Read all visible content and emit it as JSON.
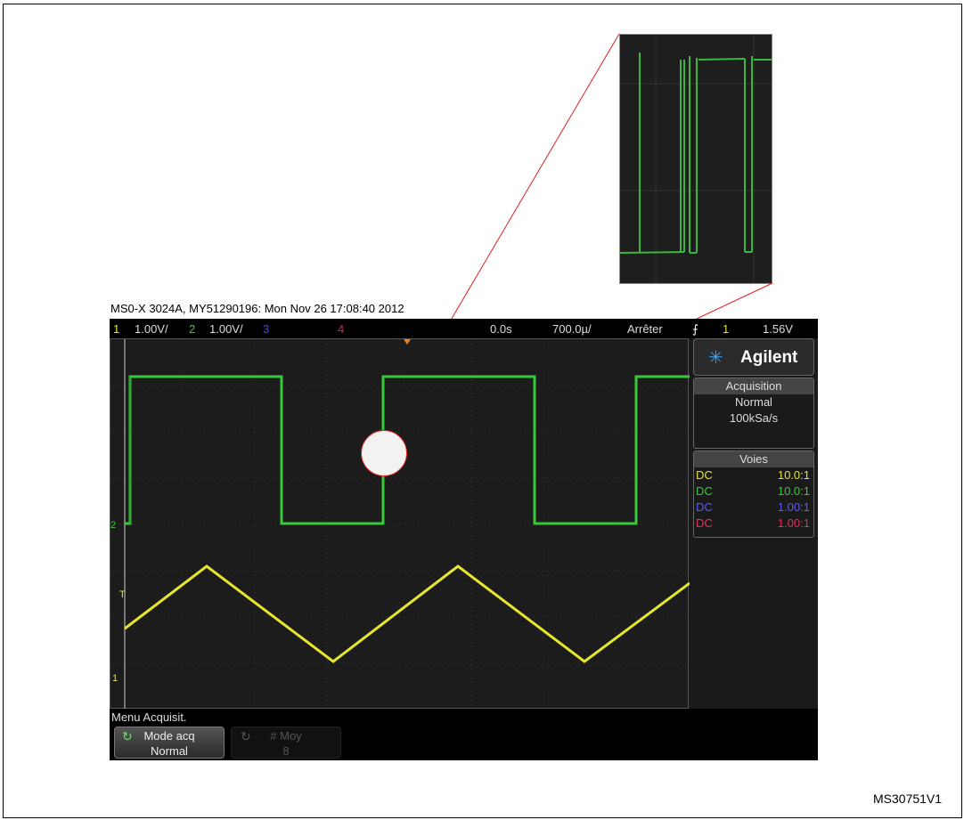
{
  "header": {
    "instrument": "MS0-X 3024A, MY51290196: Mon Nov 26 17:08:40 2012"
  },
  "topbar": {
    "ch1_num": "1",
    "ch1_scale": "1.00V/",
    "ch2_num": "2",
    "ch2_scale": "1.00V/",
    "ch3_num": "3",
    "ch4_num": "4",
    "time_offset": "0.0s",
    "time_scale": "700.0µ/",
    "run_state": "Arrêter",
    "trigger_icon": "trigger-edge-icon",
    "trigger_src": "1",
    "trigger_level": "1.56V"
  },
  "brand": {
    "name": "Agilent",
    "icon": "agilent-spark-icon"
  },
  "acquisition": {
    "title": "Acquisition",
    "mode": "Normal",
    "rate": "100kSa/s"
  },
  "voies": {
    "title": "Voies",
    "channels": [
      {
        "coupling": "DC",
        "probe": "10.0:1",
        "color": "#e6e62e"
      },
      {
        "coupling": "DC",
        "probe": "10.0:1",
        "color": "#39c83c"
      },
      {
        "coupling": "DC",
        "probe": "1.00:1",
        "color": "#5a5aff"
      },
      {
        "coupling": "DC",
        "probe": "1.00:1",
        "color": "#e8305a"
      }
    ]
  },
  "markers": {
    "ch2": "2",
    "trig": "T",
    "ch1": "1"
  },
  "menu": {
    "label": "Menu Acquisit.",
    "softkey1_top": "Mode acq",
    "softkey1_bottom": "Normal",
    "softkey2_top": "# Moy",
    "softkey2_bottom": "8"
  },
  "footer": {
    "ref": "MS30751V1"
  },
  "colors": {
    "ch1": "#e6e62e",
    "ch2": "#39c83c",
    "ch3": "#5a5aff",
    "ch4": "#e8305a"
  }
}
